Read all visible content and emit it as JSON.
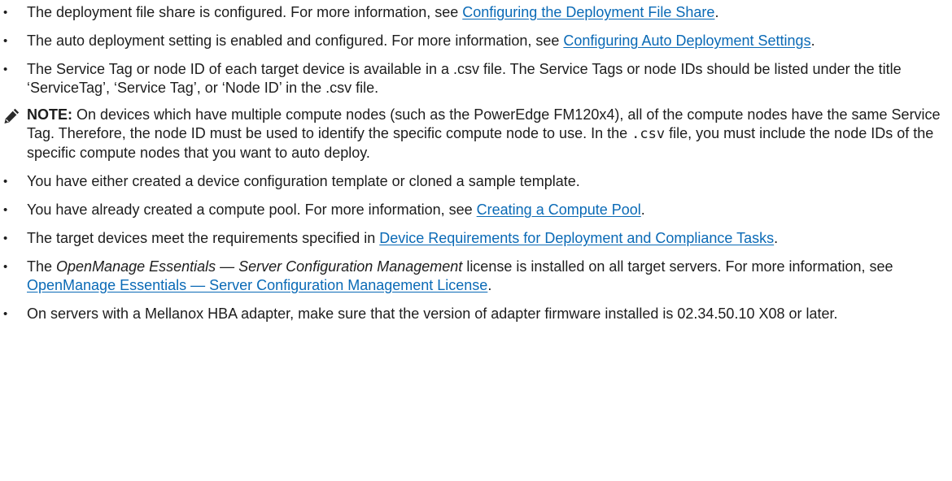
{
  "bullet_char": "•",
  "items": [
    {
      "before": "The deployment file share is configured. For more information, see ",
      "link": "Configuring the Deployment File Share",
      "after": "."
    },
    {
      "before": "The auto deployment setting is enabled and configured. For more information, see ",
      "link": "Configuring Auto Deployment Settings",
      "after": "."
    },
    {
      "text": "The Service Tag or node ID of each target device is available in a .csv file. The Service Tags or node IDs should be listed under the title ‘ServiceTag’, ‘Service Tag’, or ‘Node ID’ in the .csv file."
    },
    {
      "text": "You have either created a device configuration template or cloned a sample template."
    },
    {
      "before": "You have already created a compute pool. For more information, see ",
      "link": "Creating a Compute Pool",
      "after": "."
    },
    {
      "before": "The target devices meet the requirements specified in ",
      "link": "Device Requirements for Deployment and Compliance Tasks",
      "after": "."
    },
    {
      "before": "The ",
      "italic": "OpenManage Essentials — Server  Configuration Management",
      "middle": " license is installed on all target servers. For more information, see ",
      "link": "OpenManage Essentials — Server  Configuration Management License",
      "after": "."
    },
    {
      "text": "On servers with a Mellanox HBA adapter, make sure that the version of adapter firmware installed is 02.34.50.10 X08 or later."
    }
  ],
  "note": {
    "icon": "pencil-icon",
    "label": "NOTE:",
    "text1": " On devices which have multiple compute nodes (such as the PowerEdge FM120x4), all of the compute nodes have the same Service Tag. Therefore, the node ID must be used to identify the specific compute node to use. In the ",
    "code": ".csv",
    "text2": " file, you must include the node IDs of the specific compute nodes that you want to auto deploy."
  }
}
